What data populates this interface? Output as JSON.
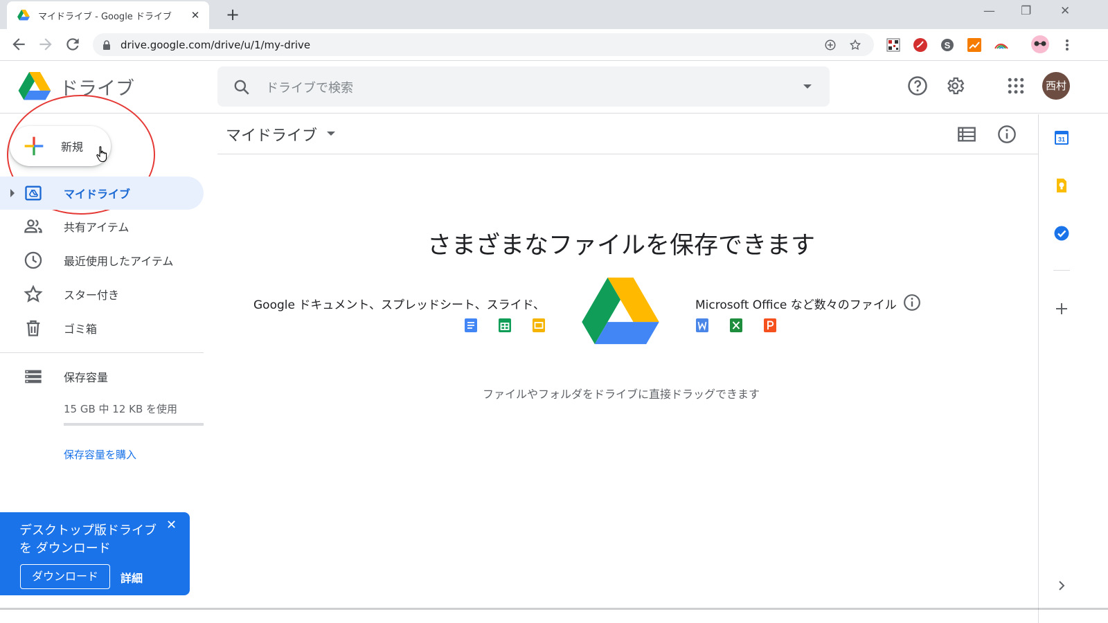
{
  "browser": {
    "tab_title": "マイドライブ - Google ドライブ",
    "tab_close": "✕",
    "new_tab": "+",
    "url": "drive.google.com/drive/u/1/my-drive",
    "window_controls": [
      "—",
      "❐",
      "✕"
    ]
  },
  "header": {
    "app_name": "ドライブ",
    "search_placeholder": "ドライブで検索",
    "avatar_text": "西村"
  },
  "sidebar": {
    "new_button": "新規",
    "items": [
      {
        "label": "マイドライブ",
        "icon": "my-drive-icon",
        "active": true
      },
      {
        "label": "共有アイテム",
        "icon": "people-icon"
      },
      {
        "label": "最近使用したアイテム",
        "icon": "clock-icon"
      },
      {
        "label": "スター付き",
        "icon": "star-icon"
      },
      {
        "label": "ゴミ箱",
        "icon": "trash-icon"
      }
    ],
    "storage_label": "保存容量",
    "storage_usage": "15 GB 中 12 KB を使用",
    "storage_fraction": 8e-07,
    "buy_storage": "保存容量を購入"
  },
  "promo": {
    "text": "デスクトップ版ドライブを ダウンロード",
    "close": "✕",
    "download": "ダウンロード",
    "details": "詳細"
  },
  "main": {
    "title": "マイドライブ",
    "empty_heading": "さまざまなファイルを保存できます",
    "google_apps_text": "Google ドキュメント、スプレッドシート、スライド、",
    "ms_apps_text": "Microsoft Office など数々のファイル",
    "drag_hint": "ファイルやフォルダをドライブに直接ドラッグできます"
  },
  "side_panel": {
    "calendar_day": "31"
  },
  "colors": {
    "accent": "#1a73e8",
    "active_bg": "#e8f0fe",
    "annotation_circle": "#e53935"
  }
}
